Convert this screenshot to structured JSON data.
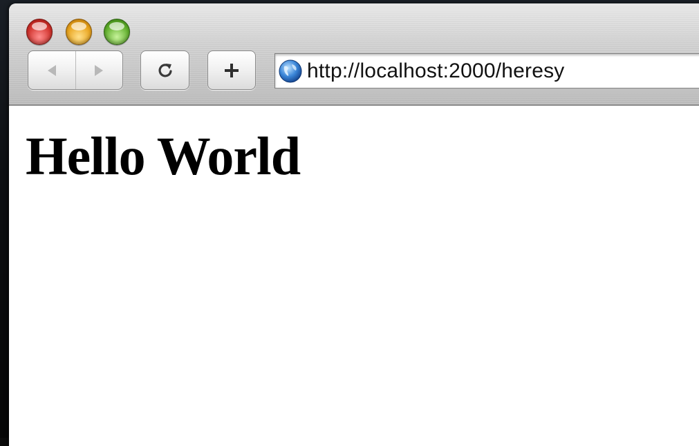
{
  "browser": {
    "window_buttons": {
      "close": "close",
      "minimize": "minimize",
      "zoom": "zoom"
    },
    "toolbar": {
      "back_icon": "back-arrow-icon",
      "forward_icon": "forward-arrow-icon",
      "reload_icon": "reload-icon",
      "add_icon": "plus-icon"
    },
    "address_bar": {
      "url": "http://localhost:2000/heresy",
      "icon": "globe-icon"
    }
  },
  "page": {
    "heading": "Hello World"
  },
  "colors": {
    "close": "#d0302a",
    "minimize": "#e8a21a",
    "zoom": "#5fae2a"
  }
}
